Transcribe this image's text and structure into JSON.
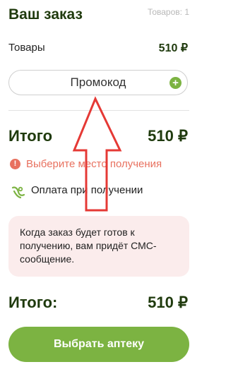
{
  "header": {
    "title": "Ваш заказ",
    "items_count": "Товаров: 1"
  },
  "goods": {
    "label": "Товары",
    "value": "510 ₽"
  },
  "promo": {
    "label": "Промокод",
    "icon": "plus-circle-icon"
  },
  "total_top": {
    "label": "Итого",
    "value": "510 ₽"
  },
  "warning": {
    "text": "Выберите место получения",
    "icon": "alert-icon"
  },
  "payment": {
    "text": "Оплата при получении",
    "icon": "cash-icon"
  },
  "note": {
    "text": "Когда заказ будет готов к получению, вам придёт СМС-сообщение."
  },
  "total_bottom": {
    "label": "Итого:",
    "value": "510 ₽"
  },
  "cta": {
    "label": "Выбрать аптеку"
  },
  "colors": {
    "accent": "#7cb342",
    "warning": "#e8715f",
    "annotation": "#e53935",
    "note_bg": "#fbecec"
  }
}
